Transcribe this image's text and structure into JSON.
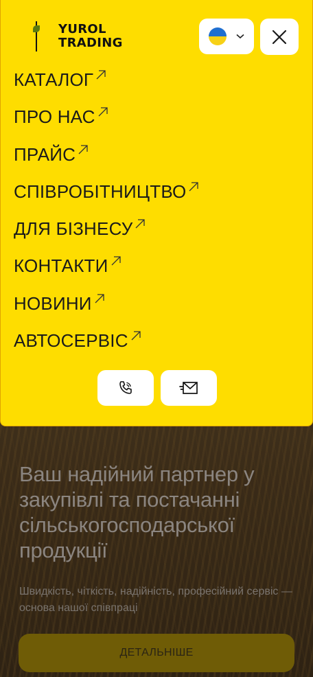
{
  "brand": {
    "line1": "YUROL",
    "line2": "TRADING"
  },
  "language": {
    "flag_icon": "ukraine-flag-icon",
    "chevron_icon": "chevron-down-icon"
  },
  "menu": {
    "items": [
      {
        "label": "КАТАЛОГ"
      },
      {
        "label": "ПРО НАС"
      },
      {
        "label": "ПРАЙС"
      },
      {
        "label": "СПІВРОБІТНИЦТВО"
      },
      {
        "label": "ДЛЯ БІЗНЕСУ"
      },
      {
        "label": "КОНТАКТИ"
      },
      {
        "label": "НОВИНИ"
      },
      {
        "label": "АВТОСЕРВІС"
      }
    ],
    "arrow_icon": "arrow-up-right-icon",
    "phone_icon": "phone-icon",
    "mail_icon": "mail-icon",
    "close_icon": "close-icon"
  },
  "hero": {
    "title": "Ваш надійний партнер у закупівлі та постачанні сільськогосподарської продукції",
    "subtitle": "Швидкість, чіткість, надійність, професійний сервіс — основа нашої співпраці",
    "cta_label": "ДЕТАЛЬНІШЕ"
  },
  "colors": {
    "menu_bg": "#fedd00",
    "cta_bg": "#6f5c06"
  }
}
